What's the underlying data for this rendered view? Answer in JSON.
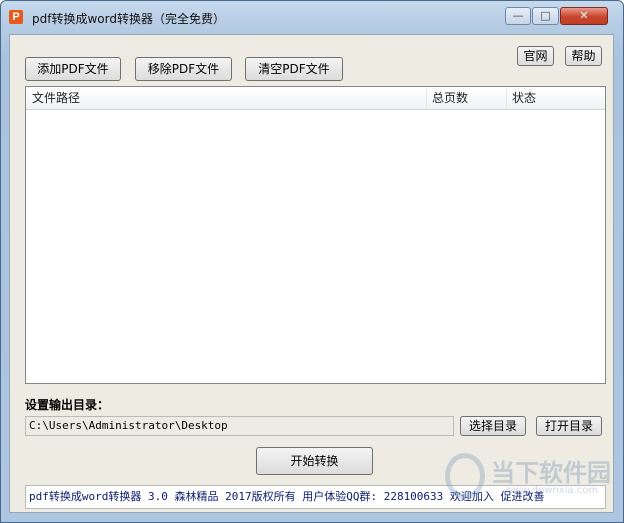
{
  "window": {
    "title": "pdf转换成word转换器（完全免费）",
    "app_icon_letter": "P",
    "controls": {
      "minimize": "—",
      "maximize": "□",
      "close": "✕"
    }
  },
  "toolbar": {
    "add_pdf": "添加PDF文件",
    "remove_pdf": "移除PDF文件",
    "clear_pdf": "清空PDF文件",
    "website": "官网",
    "help": "帮助"
  },
  "file_list": {
    "columns": [
      "文件路径",
      "总页数",
      "状态"
    ],
    "rows": []
  },
  "output": {
    "label": "设置输出目录：",
    "path": "C:\\Users\\Administrator\\Desktop",
    "choose_dir": "选择目录",
    "open_dir": "打开目录"
  },
  "actions": {
    "start": "开始转换"
  },
  "status": {
    "text": "pdf转换成word转换器 3.0 森林精品 2017版权所有 用户体验QQ群: 228100633 欢迎加入 促进改善"
  },
  "watermark": {
    "text": "当下软件园",
    "url": "www.downxia.com"
  },
  "colors": {
    "close_button": "#c8452c",
    "status_text": "#0b1c6e",
    "client_bg": "#eeebe2"
  }
}
